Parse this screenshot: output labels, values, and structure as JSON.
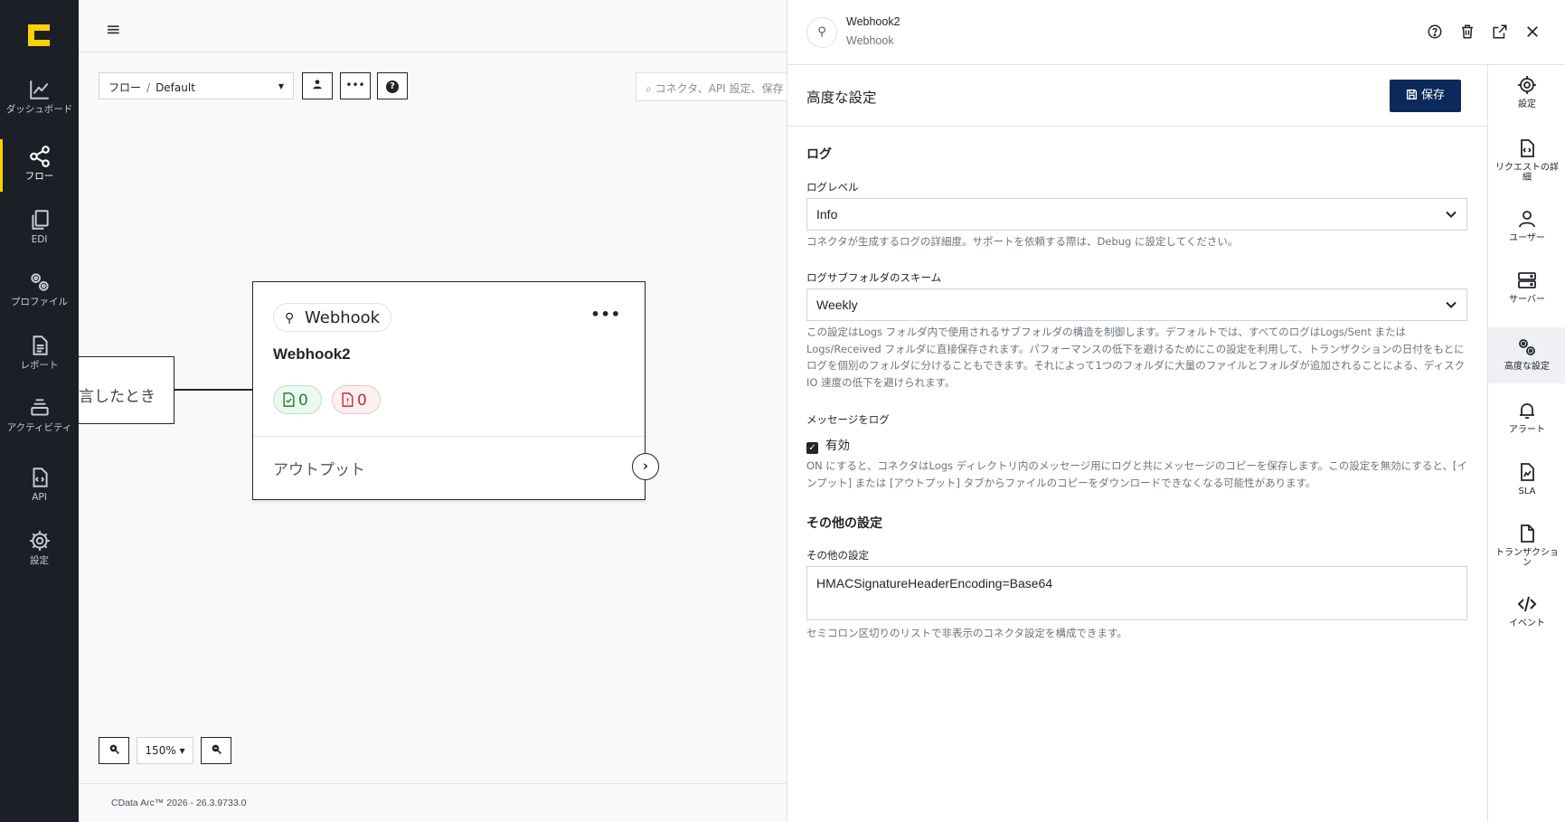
{
  "nav": {
    "items": [
      {
        "label": "ダッシュボード",
        "icon": "chart-line-icon"
      },
      {
        "label": "フロー",
        "icon": "share-nodes-icon",
        "active": true
      },
      {
        "label": "EDI",
        "icon": "documents-icon"
      },
      {
        "label": "プロファイル",
        "icon": "gears-icon"
      },
      {
        "label": "レポート",
        "icon": "report-icon"
      },
      {
        "label": "アクティビティ",
        "icon": "layers-icon"
      },
      {
        "label": "API",
        "icon": "api-file-icon"
      },
      {
        "label": "設定",
        "icon": "gear-icon"
      }
    ]
  },
  "toolbar": {
    "breadcrumb_root": "フロー",
    "breadcrumb_sep": "/",
    "workspace": "Default",
    "more_label": "•••",
    "help_label": "?",
    "search_placeholder": "コネクタ、API 設定、保存"
  },
  "canvas": {
    "trigger_text": "言したとき",
    "node": {
      "tag": "Webhook",
      "title": "Webhook2",
      "success_count": "0",
      "error_count": "0",
      "output_label": "アウトプット"
    },
    "zoom": "150%",
    "version": "CData Arc™ 2026 - 26.3.9733.0"
  },
  "panel": {
    "connector_name": "Webhook2",
    "connector_type": "Webhook",
    "section_title": "高度な設定",
    "save_label": "保存",
    "log_heading": "ログ",
    "log_level_label": "ログレベル",
    "log_level_value": "Info",
    "log_level_hint": "コネクタが生成するログの詳細度。サポートを依頼する際は、Debug に設定してください。",
    "subfolder_label": "ログサブフォルダのスキーム",
    "subfolder_value": "Weekly",
    "subfolder_hint": "この設定はLogs フォルダ内で使用されるサブフォルダの構造を制御します。デフォルトでは、すべてのログはLogs/Sent または Logs/Received フォルダに直接保存されます。パフォーマンスの低下を避けるためにこの設定を利用して、トランザクションの日付をもとにログを個別のフォルダに分けることもできます。それによって1つのフォルダに大量のファイルとフォルダが追加されることによる、ディスクIO 速度の低下を避けられます。",
    "log_messages_label": "メッセージをログ",
    "enabled_label": "有効",
    "enabled_checked": true,
    "log_messages_hint": "ON にすると、コネクタはLogs ディレクトリ内のメッセージ用にログと共にメッセージのコピーを保存します。この設定を無効にすると、[インプット] または [アウトプット] タブからファイルのコピーをダウンロードできなくなる可能性があります。",
    "other_heading": "その他の設定",
    "other_label": "その他の設定",
    "other_value": "HMACSignatureHeaderEncoding=Base64",
    "other_hint": "セミコロン区切りのリストで非表示のコネクタ設定を構成できます。"
  },
  "rail": {
    "items": [
      {
        "label": "設定",
        "icon": "gear-icon"
      },
      {
        "label": "リクエストの詳細",
        "icon": "code-file-icon"
      },
      {
        "label": "ユーザー",
        "icon": "user-icon"
      },
      {
        "label": "サーバー",
        "icon": "server-icon"
      },
      {
        "label": "高度な設定",
        "icon": "gears-icon",
        "active": true
      },
      {
        "label": "アラート",
        "icon": "bell-icon"
      },
      {
        "label": "SLA",
        "icon": "sla-file-icon"
      },
      {
        "label": "トランザクション",
        "icon": "file-icon"
      },
      {
        "label": "イベント",
        "icon": "code-icon"
      }
    ]
  },
  "colors": {
    "nav_bg": "#1c1f26",
    "accent_yellow": "#f5d400",
    "save_button": "#0b2a5b",
    "success": "#1e7e34",
    "error": "#c92a3b"
  }
}
